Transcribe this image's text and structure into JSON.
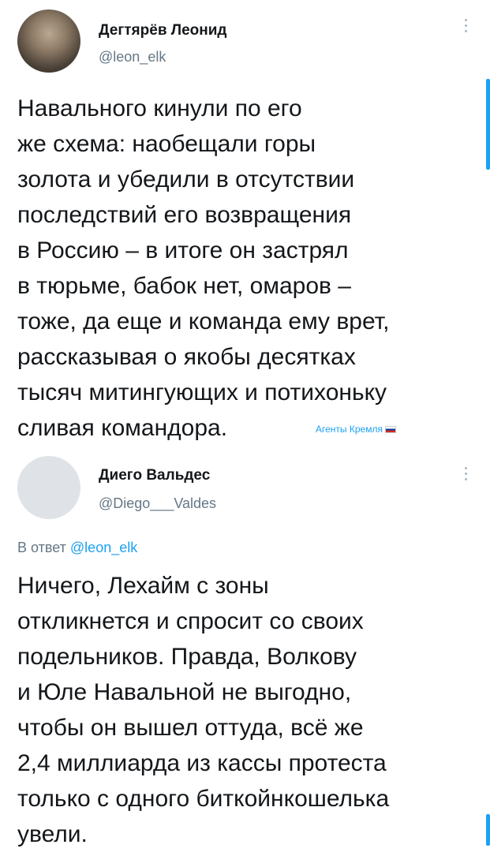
{
  "tweets": [
    {
      "name": "Дегтярёв Леонид",
      "handle": "@leon_elk",
      "lines": [
        "Навального кинули по его",
        "же схема: наобещали горы",
        "золота и убедили в отсутствии",
        "последствий его возвращения",
        "в Россию – в итоге он застрял",
        "в тюрьме, бабок нет, омаров –",
        "тоже, да еще и команда ему врет,",
        "рассказывая о якобы десятках",
        "тысяч митингующих и потихоньку",
        "сливая командора."
      ],
      "watermark": "Агенты Кремля"
    },
    {
      "name": "Диего Вальдес",
      "handle": "@Diego___Valdes",
      "reply_prefix": "В ответ",
      "reply_handle": "@leon_elk",
      "lines": [
        "Ничего, Лехайм с зоны",
        "откликнется и спросит со своих",
        "подельников. Правда, Волкову",
        "и Юле Навальной не выгодно,",
        "чтобы он вышел оттуда, всё же",
        "2,4 миллиарда из кассы протеста",
        "только с одного биткойнкошелька",
        "увели."
      ]
    }
  ],
  "colors": {
    "accent": "#1da1f2",
    "secondary_text": "#657786",
    "text": "#14171a"
  }
}
